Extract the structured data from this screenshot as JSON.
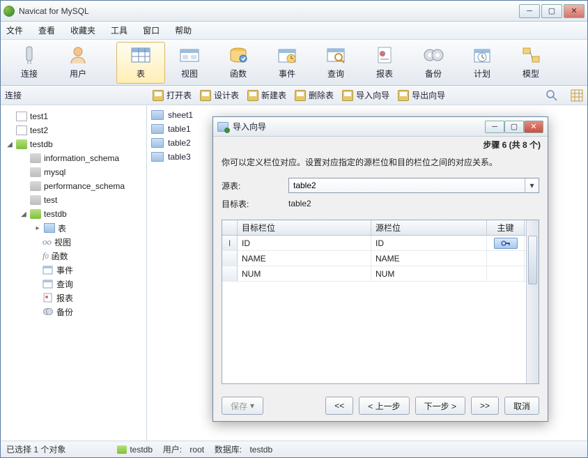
{
  "window": {
    "title": "Navicat for MySQL"
  },
  "menu": {
    "file": "文件",
    "view": "查看",
    "fav": "收藏夹",
    "tools": "工具",
    "window": "窗口",
    "help": "帮助"
  },
  "toolbar": {
    "connect": "连接",
    "user": "用户",
    "table": "表",
    "view": "视图",
    "func": "函数",
    "event": "事件",
    "query": "查询",
    "report": "报表",
    "backup": "备份",
    "schedule": "计划",
    "model": "模型"
  },
  "sectb": {
    "label": "连接",
    "open_table": "打开表",
    "design_table": "设计表",
    "new_table": "新建表",
    "delete_table": "删除表",
    "import": "导入向导",
    "export": "导出向导"
  },
  "tree": {
    "test1": "test1",
    "test2": "test2",
    "testdb": "testdb",
    "info_schema": "information_schema",
    "mysql": "mysql",
    "perf_schema": "performance_schema",
    "test": "test",
    "testdb2": "testdb",
    "tables": "表",
    "views": "视图",
    "funcs": "函数",
    "events": "事件",
    "queries": "查询",
    "reports": "报表",
    "backups": "备份"
  },
  "objects": {
    "sheet1": "sheet1",
    "table1": "table1",
    "table2": "table2",
    "table3": "table3"
  },
  "dialog": {
    "title": "导入向导",
    "step": "步骤 6 (共 8 个)",
    "desc": "你可以定义栏位对应。设置对应指定的源栏位和目的栏位之间的对应关系。",
    "src_label": "源表:",
    "src_value": "table2",
    "dst_label": "目标表:",
    "dst_value": "table2",
    "col_target": "目标栏位",
    "col_source": "源栏位",
    "col_pk": "主键",
    "rows": [
      {
        "target": "ID",
        "source": "ID",
        "pk": true,
        "cursor": true
      },
      {
        "target": "NAME",
        "source": "NAME",
        "pk": false,
        "cursor": false
      },
      {
        "target": "NUM",
        "source": "NUM",
        "pk": false,
        "cursor": false
      }
    ],
    "save": "保存",
    "first": "<<",
    "prev": "< 上一步",
    "next": "下一步 >",
    "last": ">>",
    "cancel": "取消"
  },
  "status": {
    "selection": "已选择 1 个对象",
    "db": "testdb",
    "user_label": "用户:",
    "user": "root",
    "db_label": "数据库:",
    "dbname": "testdb"
  }
}
